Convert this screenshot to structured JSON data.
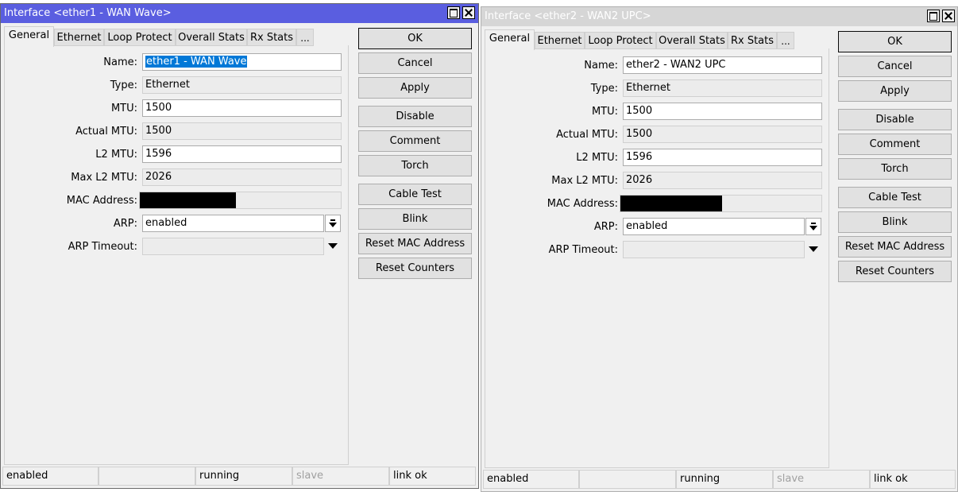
{
  "window1": {
    "title": "Interface <ether1 - WAN Wave>",
    "colors": {
      "titlebar": "#5a5ee0",
      "title_text": "#ffffff"
    },
    "tabs": [
      "General",
      "Ethernet",
      "Loop Protect",
      "Overall Stats",
      "Rx Stats",
      "..."
    ],
    "active_tab": "General",
    "fields": {
      "name_label": "Name:",
      "name_value": "ether1 - WAN Wave",
      "type_label": "Type:",
      "type_value": "Ethernet",
      "mtu_label": "MTU:",
      "mtu_value": "1500",
      "actual_mtu_label": "Actual MTU:",
      "actual_mtu_value": "1500",
      "l2mtu_label": "L2 MTU:",
      "l2mtu_value": "1596",
      "max_l2mtu_label": "Max L2 MTU:",
      "max_l2mtu_value": "2026",
      "mac_label": "MAC Address:",
      "arp_label": "ARP:",
      "arp_value": "enabled",
      "arp_timeout_label": "ARP Timeout:"
    },
    "buttons": [
      "OK",
      "Cancel",
      "Apply",
      "Disable",
      "Comment",
      "Torch",
      "Cable Test",
      "Blink",
      "Reset MAC Address",
      "Reset Counters"
    ],
    "status": [
      "enabled",
      "",
      "running",
      "slave",
      "link ok"
    ]
  },
  "window2": {
    "title": "Interface <ether2 - WAN2 UPC>",
    "colors": {
      "titlebar": "#d6d6d6",
      "title_text": "#ffffff"
    },
    "tabs": [
      "General",
      "Ethernet",
      "Loop Protect",
      "Overall Stats",
      "Rx Stats",
      "..."
    ],
    "active_tab": "General",
    "fields": {
      "name_label": "Name:",
      "name_value": "ether2 - WAN2 UPC",
      "type_label": "Type:",
      "type_value": "Ethernet",
      "mtu_label": "MTU:",
      "mtu_value": "1500",
      "actual_mtu_label": "Actual MTU:",
      "actual_mtu_value": "1500",
      "l2mtu_label": "L2 MTU:",
      "l2mtu_value": "1596",
      "max_l2mtu_label": "Max L2 MTU:",
      "max_l2mtu_value": "2026",
      "mac_label": "MAC Address:",
      "arp_label": "ARP:",
      "arp_value": "enabled",
      "arp_timeout_label": "ARP Timeout:"
    },
    "buttons": [
      "OK",
      "Cancel",
      "Apply",
      "Disable",
      "Comment",
      "Torch",
      "Cable Test",
      "Blink",
      "Reset MAC Address",
      "Reset Counters"
    ],
    "status": [
      "enabled",
      "",
      "running",
      "slave",
      "link ok"
    ]
  }
}
